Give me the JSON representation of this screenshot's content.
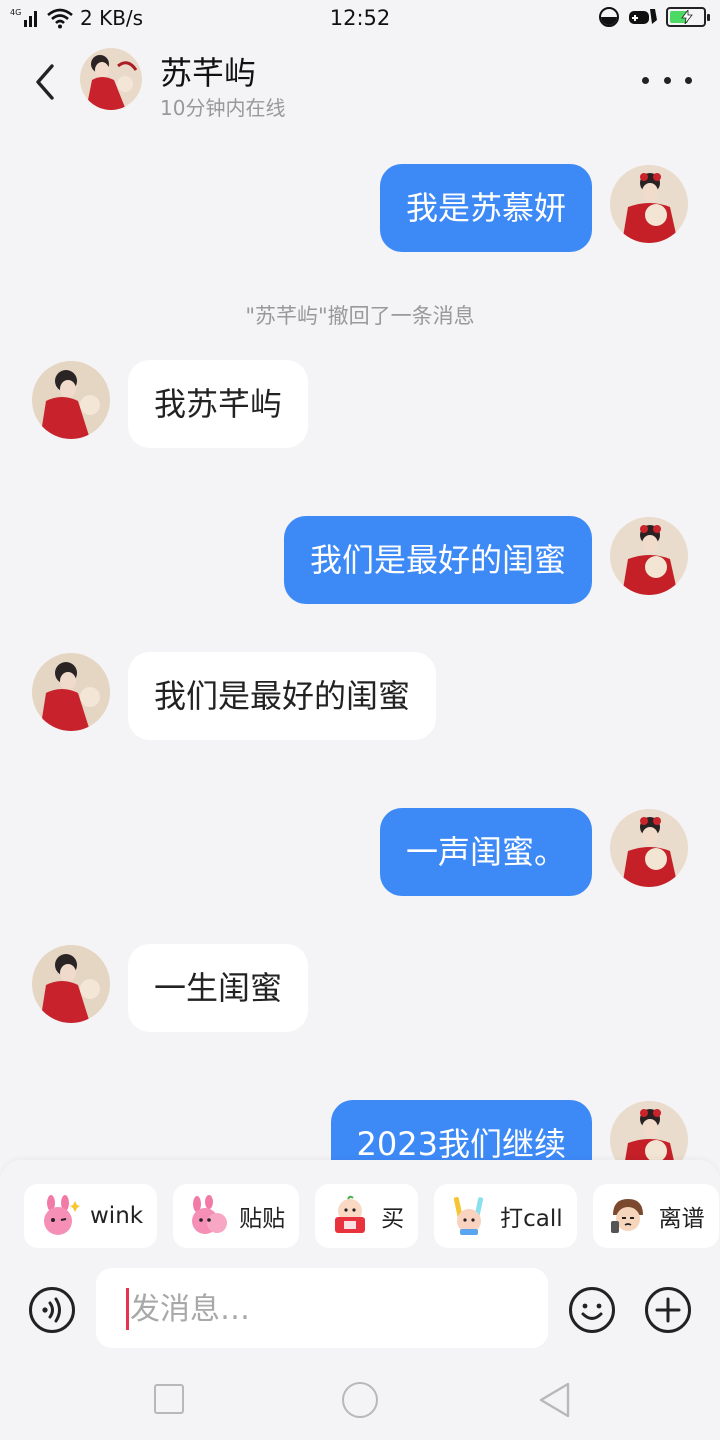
{
  "status_bar": {
    "network": "4G",
    "speed": "2 KB/s",
    "time": "12:52",
    "battery_level": 0.55
  },
  "header": {
    "name": "苏芊屿",
    "status": "10分钟内在线"
  },
  "messages": [
    {
      "side": "me",
      "text": "我是苏慕妍"
    },
    {
      "side": "notice",
      "text": "\"苏芊屿\"撤回了一条消息"
    },
    {
      "side": "other",
      "text": "我苏芊屿"
    },
    {
      "side": "me",
      "text": "我们是最好的闺蜜"
    },
    {
      "side": "other",
      "text": "我们是最好的闺蜜"
    },
    {
      "side": "me",
      "text": "一声闺蜜。"
    },
    {
      "side": "other",
      "text": "一生闺蜜"
    },
    {
      "side": "me",
      "text": "2023我们继续"
    }
  ],
  "quick_replies": [
    {
      "label": "wink",
      "icon": "pink-bunny-wink-icon"
    },
    {
      "label": "贴贴",
      "icon": "pink-bunny-hug-icon"
    },
    {
      "label": "买",
      "icon": "buy-sticker-icon"
    },
    {
      "label": "打call",
      "icon": "lightstick-call-icon"
    },
    {
      "label": "离谱",
      "icon": "speechless-face-icon"
    }
  ],
  "input": {
    "placeholder": "发消息…"
  },
  "colors": {
    "my_bubble": "#3d8af7",
    "other_bubble": "#ffffff",
    "background": "#f4f4f6",
    "caret": "#e8334f"
  }
}
